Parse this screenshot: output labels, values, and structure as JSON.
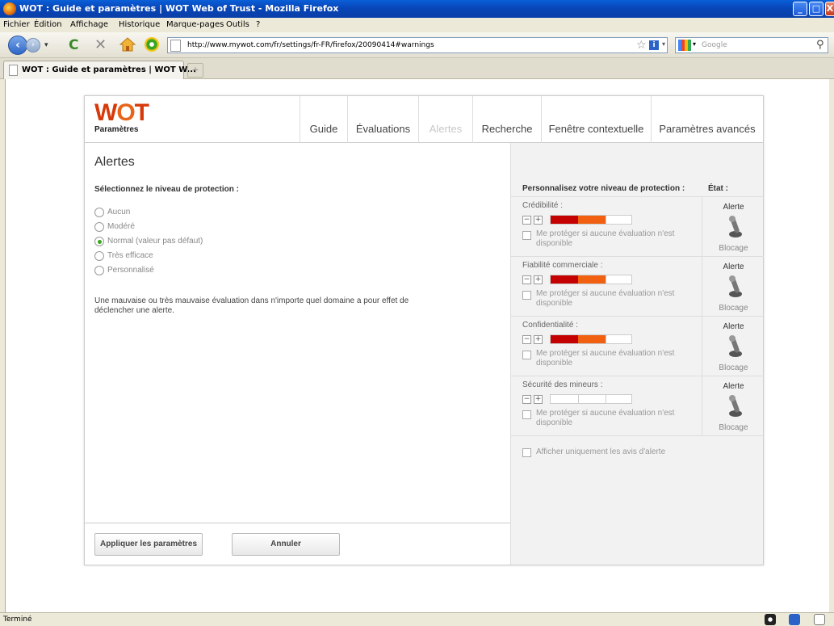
{
  "window": {
    "title": "WOT : Guide et paramètres | WOT Web of Trust - Mozilla Firefox",
    "minimize": "_",
    "maximize": "□",
    "close": "X"
  },
  "menu": [
    "Fichier",
    "Édition",
    "Affichage",
    "Historique",
    "Marque-pages",
    "Outils",
    "?"
  ],
  "navbar": {
    "url": "http://www.mywot.com/fr/settings/fr-FR/firefox/20090414#warnings",
    "search_placeholder": "Google"
  },
  "tab": {
    "label": "WOT : Guide et paramètres | WOT W...",
    "new_tab": "+"
  },
  "wot": {
    "logo": "WOT",
    "subtitle": "Paramètres",
    "nav": [
      "Guide",
      "Évaluations",
      "Alertes",
      "Recherche",
      "Fenêtre contextuelle",
      "Paramètres avancés"
    ],
    "section_title": "Alertes",
    "sub_title": "Sélectionnez le niveau de protection :",
    "levels": [
      {
        "label": "Aucun",
        "checked": false
      },
      {
        "label": "Modéré",
        "checked": false
      },
      {
        "label": "Normal (valeur pas défaut)",
        "checked": true
      },
      {
        "label": "Très efficace",
        "checked": false
      },
      {
        "label": "Personnalisé",
        "checked": false
      }
    ],
    "description": "Une mauvaise ou très mauvaise évaluation dans n'importe quel domaine a pour effet de déclencher une alerte.",
    "apply_button": "Appliquer les paramètres",
    "cancel_button": "Annuler",
    "custom_header": "Personnalisez votre niveau de protection :",
    "state_header": "État :",
    "components": [
      {
        "name": "Crédibilité :",
        "level": 2,
        "checkbox_label": "Me protéger si aucune évaluation n'est disponible",
        "alert": "Alerte",
        "block": "Blocage"
      },
      {
        "name": "Fiabilité commerciale :",
        "level": 2,
        "checkbox_label": "Me protéger si aucune évaluation n'est disponible",
        "alert": "Alerte",
        "block": "Blocage"
      },
      {
        "name": "Confidentialité :",
        "level": 2,
        "checkbox_label": "Me protéger si aucune évaluation n'est disponible",
        "alert": "Alerte",
        "block": "Blocage"
      },
      {
        "name": "Sécurité des mineurs :",
        "level": 0,
        "checkbox_label": "Me protéger si aucune évaluation n'est disponible",
        "alert": "Alerte",
        "block": "Blocage"
      }
    ],
    "only_alerts_label": "Afficher uniquement les avis d'alerte",
    "minus": "−",
    "plus": "+",
    "colors": {
      "dark_red": "#c40000",
      "orange": "#f06010",
      "brand": "#d63a0a"
    }
  },
  "status": {
    "text": "Terminé"
  }
}
